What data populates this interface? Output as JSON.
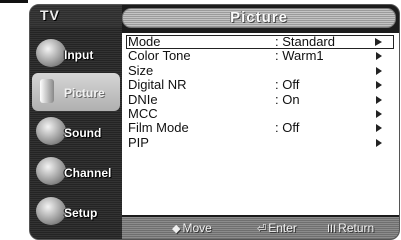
{
  "header": {
    "input_label": "TV",
    "title": "Picture"
  },
  "sidebar": {
    "items": [
      {
        "label": "Input",
        "icon": "plug-icon"
      },
      {
        "label": "Picture",
        "icon": "picture-icon"
      },
      {
        "label": "Sound",
        "icon": "speaker-icon"
      },
      {
        "label": "Channel",
        "icon": "satellite-icon"
      },
      {
        "label": "Setup",
        "icon": "gear-icon"
      }
    ]
  },
  "menu": {
    "rows": [
      {
        "label": "Mode",
        "value": ": Standard"
      },
      {
        "label": "Color Tone",
        "value": ": Warm1"
      },
      {
        "label": "Size",
        "value": ""
      },
      {
        "label": "Digital NR",
        "value": ": Off"
      },
      {
        "label": "DNIe",
        "value": ": On"
      },
      {
        "label": "MCC",
        "value": ""
      },
      {
        "label": "Film Mode",
        "value": ": Off"
      },
      {
        "label": "PIP",
        "value": ""
      }
    ]
  },
  "footer": {
    "move_glyph": "◆",
    "move_label": "Move",
    "enter_glyph": "⏎",
    "enter_label": "Enter",
    "return_glyph": "III",
    "return_label": "Return"
  }
}
